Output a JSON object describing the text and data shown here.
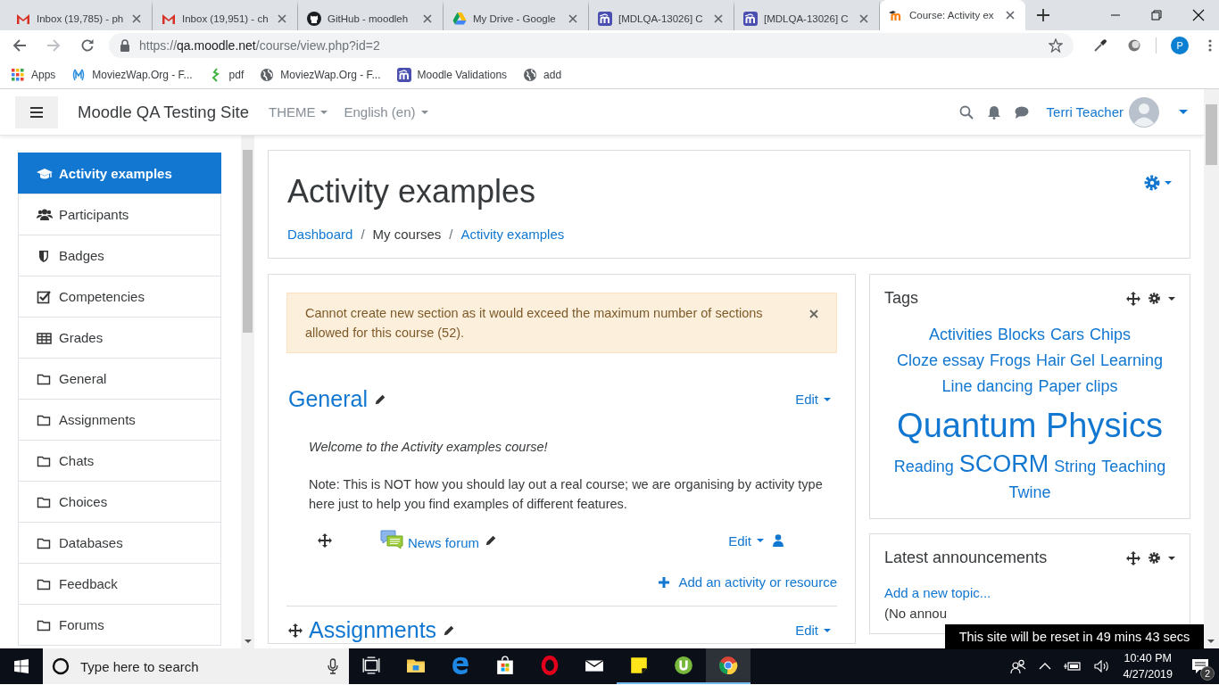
{
  "browser": {
    "tabs": [
      {
        "title": "Inbox (19,785) - ph",
        "kind": "gmail",
        "selected": false
      },
      {
        "title": "Inbox (19,951) - ch",
        "kind": "gmail",
        "selected": false
      },
      {
        "title": "GitHub - moodleh",
        "kind": "github",
        "selected": false
      },
      {
        "title": "My Drive - Google",
        "kind": "drive",
        "selected": false
      },
      {
        "title": "[MDLQA-13026] C",
        "kind": "moodle",
        "selected": false
      },
      {
        "title": "[MDLQA-13026] C",
        "kind": "moodle",
        "selected": false
      },
      {
        "title": "Course: Activity ex",
        "kind": "moodleorange",
        "selected": true
      }
    ],
    "forward_enabled": false,
    "url": {
      "scheme": "https://",
      "host": "qa.moodle.net",
      "path": "/course/view.php?id=2"
    },
    "bookmarks": [
      {
        "label": "Apps",
        "kind": "apps"
      },
      {
        "label": "MoviezWap.Org - F...",
        "kind": "mw"
      },
      {
        "label": "pdf",
        "kind": "pdf"
      },
      {
        "label": "MoviezWap.Org - F...",
        "kind": "globe"
      },
      {
        "label": "Moodle Validations",
        "kind": "moodle"
      },
      {
        "label": "add",
        "kind": "globe"
      }
    ],
    "profile_initial": "P"
  },
  "navbar": {
    "site_name": "Moodle QA Testing Site",
    "menus": [
      "THEME",
      "English (en)"
    ],
    "user_name": "Terri Teacher"
  },
  "drawer": {
    "items": [
      {
        "label": "Activity examples",
        "kind": "cap",
        "selected": true
      },
      {
        "label": "Participants",
        "kind": "users",
        "selected": false
      },
      {
        "label": "Badges",
        "kind": "shield",
        "selected": false
      },
      {
        "label": "Competencies",
        "kind": "check",
        "selected": false
      },
      {
        "label": "Grades",
        "kind": "table",
        "selected": false
      },
      {
        "label": "General",
        "kind": "folder",
        "selected": false
      },
      {
        "label": "Assignments",
        "kind": "folder",
        "selected": false
      },
      {
        "label": "Chats",
        "kind": "folder",
        "selected": false
      },
      {
        "label": "Choices",
        "kind": "folder",
        "selected": false
      },
      {
        "label": "Databases",
        "kind": "folder",
        "selected": false
      },
      {
        "label": "Feedback",
        "kind": "folder",
        "selected": false
      },
      {
        "label": "Forums",
        "kind": "folder",
        "selected": false
      }
    ]
  },
  "course": {
    "title": "Activity examples",
    "breadcrumbs": [
      {
        "label": "Dashboard",
        "kind": "link"
      },
      {
        "label": "/",
        "kind": "separator"
      },
      {
        "label": "My courses",
        "kind": "text"
      },
      {
        "label": "/",
        "kind": "separator"
      },
      {
        "label": "Activity examples",
        "kind": "link"
      }
    ],
    "alert": "Cannot create new section as it would exceed the maximum number of sections allowed for this course (52).",
    "sections": [
      {
        "title": "General",
        "edit": "Edit",
        "summary": [
          "Welcome to the Activity examples course!",
          "Note: This is NOT how you should lay out a real course; we are organising by activity type here just to help you find examples of different features."
        ],
        "activities": [
          {
            "name": "News forum",
            "edit": "Edit"
          }
        ],
        "add_activity": "Add an activity or resource"
      },
      {
        "title": "Assignments",
        "edit": "Edit"
      }
    ]
  },
  "tags_block": {
    "title": "Tags",
    "tags": [
      {
        "label": "Activities",
        "kind": "normal"
      },
      {
        "label": "Blocks",
        "kind": "normal"
      },
      {
        "label": "Cars",
        "kind": "normal"
      },
      {
        "label": "Chips",
        "kind": "normal"
      },
      {
        "label": "Cloze essay",
        "kind": "normal"
      },
      {
        "label": "Frogs",
        "kind": "normal"
      },
      {
        "label": "Hair Gel",
        "kind": "normal"
      },
      {
        "label": "Learning",
        "kind": "normal"
      },
      {
        "label": "Line dancing",
        "kind": "normal"
      },
      {
        "label": "Paper clips",
        "kind": "normal"
      },
      {
        "label": "Quantum Physics",
        "kind": "huge"
      },
      {
        "label": "Reading",
        "kind": "normal"
      },
      {
        "label": "SCORM",
        "kind": "large"
      },
      {
        "label": "String",
        "kind": "normal"
      },
      {
        "label": "Teaching",
        "kind": "normal"
      },
      {
        "label": "Twine",
        "kind": "normal"
      }
    ]
  },
  "announcements_block": {
    "title": "Latest announcements",
    "link": "Add a new topic...",
    "note": "(No annou"
  },
  "reset_banner": "This site will be reset in 49 mins 43 secs",
  "taskbar": {
    "search_placeholder": "Type here to search",
    "apps": [
      {
        "kind": "taskview",
        "running": false,
        "selected": false
      },
      {
        "kind": "folder",
        "running": false,
        "selected": false
      },
      {
        "kind": "edge",
        "running": false,
        "selected": false
      },
      {
        "kind": "store",
        "running": false,
        "selected": false
      },
      {
        "kind": "opera",
        "running": false,
        "selected": false
      },
      {
        "kind": "mail",
        "running": false,
        "selected": false
      },
      {
        "kind": "sticky",
        "running": true,
        "selected": false
      },
      {
        "kind": "torrent",
        "running": true,
        "selected": false
      },
      {
        "kind": "chrome",
        "running": true,
        "selected": true
      }
    ],
    "time": "10:40 PM",
    "date": "4/27/2019",
    "notifications": "2"
  }
}
